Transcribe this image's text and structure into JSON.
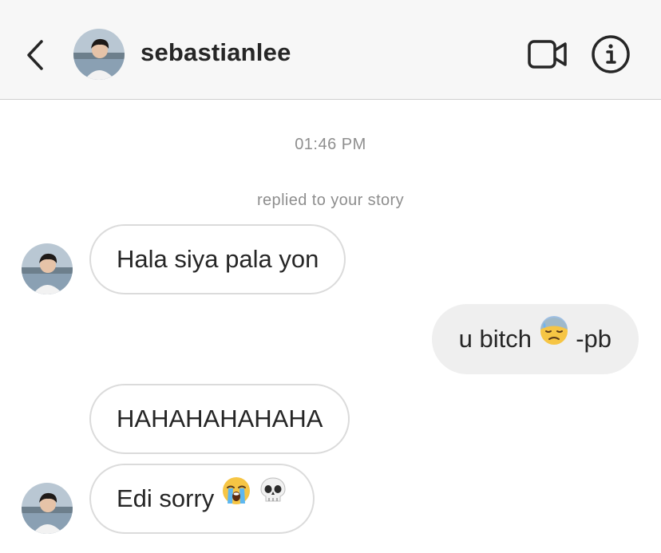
{
  "header": {
    "username": "sebastianlee",
    "back_icon": "chevron-left-icon",
    "video_icon": "video-camera-icon",
    "info_icon": "info-icon"
  },
  "thread": {
    "timestamp": "01:46 PM",
    "story_reply_note": "replied to your story",
    "messages": [
      {
        "sender": "them",
        "text": "Hala siya pala yon"
      },
      {
        "sender": "me",
        "text_before": "u bitch",
        "emoji": "downcast-sweat-emoji",
        "text_after": "-pb"
      },
      {
        "sender": "them",
        "text": "HAHAHAHAHAHA"
      },
      {
        "sender": "them",
        "text": "Edi sorry",
        "emojis": [
          "loudly-crying-emoji",
          "skull-emoji"
        ]
      }
    ]
  },
  "colors": {
    "header_bg": "#f7f7f7",
    "text": "#262626",
    "meta_text": "#8e8e8e",
    "incoming_border": "#dbdbdb",
    "outgoing_bg": "#efefef"
  }
}
